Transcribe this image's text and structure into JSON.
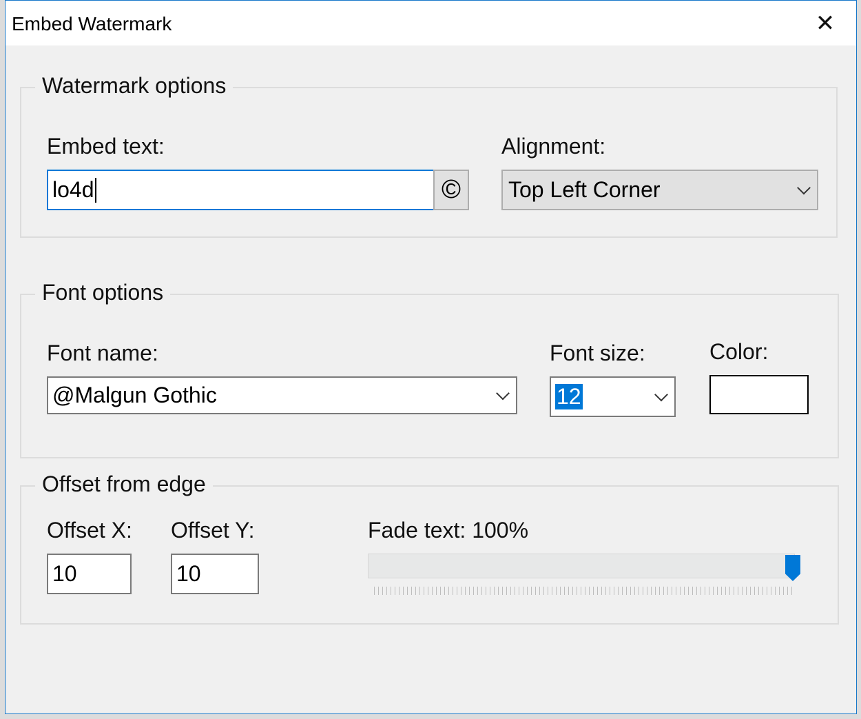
{
  "window": {
    "title": "Embed Watermark",
    "close_icon": "close-icon"
  },
  "watermark_options": {
    "legend": "Watermark options",
    "embed_text_label": "Embed text:",
    "embed_text_value": "lo4d",
    "copyright_button": "©",
    "alignment_label": "Alignment:",
    "alignment_value": "Top Left Corner"
  },
  "font_options": {
    "legend": "Font options",
    "font_name_label": "Font name:",
    "font_name_value": "@Malgun Gothic",
    "font_size_label": "Font size:",
    "font_size_value": "12",
    "color_label": "Color:",
    "color_value": "#ffffff"
  },
  "offset": {
    "legend": "Offset from edge",
    "offset_x_label": "Offset X:",
    "offset_x_value": "10",
    "offset_y_label": "Offset Y:",
    "offset_y_value": "10",
    "fade_label": "Fade text:",
    "fade_value": "100%",
    "fade_percent": 100
  },
  "accent": "#0078d7"
}
